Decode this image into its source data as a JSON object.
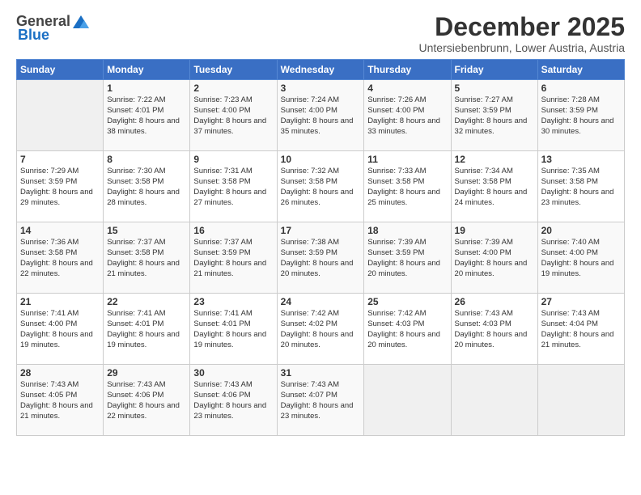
{
  "logo": {
    "general": "General",
    "blue": "Blue"
  },
  "header": {
    "title": "December 2025",
    "subtitle": "Untersiebenbrunn, Lower Austria, Austria"
  },
  "weekdays": [
    "Sunday",
    "Monday",
    "Tuesday",
    "Wednesday",
    "Thursday",
    "Friday",
    "Saturday"
  ],
  "weeks": [
    [
      {
        "day": "",
        "sunrise": "",
        "sunset": "",
        "daylight": ""
      },
      {
        "day": "1",
        "sunrise": "Sunrise: 7:22 AM",
        "sunset": "Sunset: 4:01 PM",
        "daylight": "Daylight: 8 hours and 38 minutes."
      },
      {
        "day": "2",
        "sunrise": "Sunrise: 7:23 AM",
        "sunset": "Sunset: 4:00 PM",
        "daylight": "Daylight: 8 hours and 37 minutes."
      },
      {
        "day": "3",
        "sunrise": "Sunrise: 7:24 AM",
        "sunset": "Sunset: 4:00 PM",
        "daylight": "Daylight: 8 hours and 35 minutes."
      },
      {
        "day": "4",
        "sunrise": "Sunrise: 7:26 AM",
        "sunset": "Sunset: 4:00 PM",
        "daylight": "Daylight: 8 hours and 33 minutes."
      },
      {
        "day": "5",
        "sunrise": "Sunrise: 7:27 AM",
        "sunset": "Sunset: 3:59 PM",
        "daylight": "Daylight: 8 hours and 32 minutes."
      },
      {
        "day": "6",
        "sunrise": "Sunrise: 7:28 AM",
        "sunset": "Sunset: 3:59 PM",
        "daylight": "Daylight: 8 hours and 30 minutes."
      }
    ],
    [
      {
        "day": "7",
        "sunrise": "Sunrise: 7:29 AM",
        "sunset": "Sunset: 3:59 PM",
        "daylight": "Daylight: 8 hours and 29 minutes."
      },
      {
        "day": "8",
        "sunrise": "Sunrise: 7:30 AM",
        "sunset": "Sunset: 3:58 PM",
        "daylight": "Daylight: 8 hours and 28 minutes."
      },
      {
        "day": "9",
        "sunrise": "Sunrise: 7:31 AM",
        "sunset": "Sunset: 3:58 PM",
        "daylight": "Daylight: 8 hours and 27 minutes."
      },
      {
        "day": "10",
        "sunrise": "Sunrise: 7:32 AM",
        "sunset": "Sunset: 3:58 PM",
        "daylight": "Daylight: 8 hours and 26 minutes."
      },
      {
        "day": "11",
        "sunrise": "Sunrise: 7:33 AM",
        "sunset": "Sunset: 3:58 PM",
        "daylight": "Daylight: 8 hours and 25 minutes."
      },
      {
        "day": "12",
        "sunrise": "Sunrise: 7:34 AM",
        "sunset": "Sunset: 3:58 PM",
        "daylight": "Daylight: 8 hours and 24 minutes."
      },
      {
        "day": "13",
        "sunrise": "Sunrise: 7:35 AM",
        "sunset": "Sunset: 3:58 PM",
        "daylight": "Daylight: 8 hours and 23 minutes."
      }
    ],
    [
      {
        "day": "14",
        "sunrise": "Sunrise: 7:36 AM",
        "sunset": "Sunset: 3:58 PM",
        "daylight": "Daylight: 8 hours and 22 minutes."
      },
      {
        "day": "15",
        "sunrise": "Sunrise: 7:37 AM",
        "sunset": "Sunset: 3:58 PM",
        "daylight": "Daylight: 8 hours and 21 minutes."
      },
      {
        "day": "16",
        "sunrise": "Sunrise: 7:37 AM",
        "sunset": "Sunset: 3:59 PM",
        "daylight": "Daylight: 8 hours and 21 minutes."
      },
      {
        "day": "17",
        "sunrise": "Sunrise: 7:38 AM",
        "sunset": "Sunset: 3:59 PM",
        "daylight": "Daylight: 8 hours and 20 minutes."
      },
      {
        "day": "18",
        "sunrise": "Sunrise: 7:39 AM",
        "sunset": "Sunset: 3:59 PM",
        "daylight": "Daylight: 8 hours and 20 minutes."
      },
      {
        "day": "19",
        "sunrise": "Sunrise: 7:39 AM",
        "sunset": "Sunset: 4:00 PM",
        "daylight": "Daylight: 8 hours and 20 minutes."
      },
      {
        "day": "20",
        "sunrise": "Sunrise: 7:40 AM",
        "sunset": "Sunset: 4:00 PM",
        "daylight": "Daylight: 8 hours and 19 minutes."
      }
    ],
    [
      {
        "day": "21",
        "sunrise": "Sunrise: 7:41 AM",
        "sunset": "Sunset: 4:00 PM",
        "daylight": "Daylight: 8 hours and 19 minutes."
      },
      {
        "day": "22",
        "sunrise": "Sunrise: 7:41 AM",
        "sunset": "Sunset: 4:01 PM",
        "daylight": "Daylight: 8 hours and 19 minutes."
      },
      {
        "day": "23",
        "sunrise": "Sunrise: 7:41 AM",
        "sunset": "Sunset: 4:01 PM",
        "daylight": "Daylight: 8 hours and 19 minutes."
      },
      {
        "day": "24",
        "sunrise": "Sunrise: 7:42 AM",
        "sunset": "Sunset: 4:02 PM",
        "daylight": "Daylight: 8 hours and 20 minutes."
      },
      {
        "day": "25",
        "sunrise": "Sunrise: 7:42 AM",
        "sunset": "Sunset: 4:03 PM",
        "daylight": "Daylight: 8 hours and 20 minutes."
      },
      {
        "day": "26",
        "sunrise": "Sunrise: 7:43 AM",
        "sunset": "Sunset: 4:03 PM",
        "daylight": "Daylight: 8 hours and 20 minutes."
      },
      {
        "day": "27",
        "sunrise": "Sunrise: 7:43 AM",
        "sunset": "Sunset: 4:04 PM",
        "daylight": "Daylight: 8 hours and 21 minutes."
      }
    ],
    [
      {
        "day": "28",
        "sunrise": "Sunrise: 7:43 AM",
        "sunset": "Sunset: 4:05 PM",
        "daylight": "Daylight: 8 hours and 21 minutes."
      },
      {
        "day": "29",
        "sunrise": "Sunrise: 7:43 AM",
        "sunset": "Sunset: 4:06 PM",
        "daylight": "Daylight: 8 hours and 22 minutes."
      },
      {
        "day": "30",
        "sunrise": "Sunrise: 7:43 AM",
        "sunset": "Sunset: 4:06 PM",
        "daylight": "Daylight: 8 hours and 23 minutes."
      },
      {
        "day": "31",
        "sunrise": "Sunrise: 7:43 AM",
        "sunset": "Sunset: 4:07 PM",
        "daylight": "Daylight: 8 hours and 23 minutes."
      },
      {
        "day": "",
        "sunrise": "",
        "sunset": "",
        "daylight": ""
      },
      {
        "day": "",
        "sunrise": "",
        "sunset": "",
        "daylight": ""
      },
      {
        "day": "",
        "sunrise": "",
        "sunset": "",
        "daylight": ""
      }
    ]
  ]
}
